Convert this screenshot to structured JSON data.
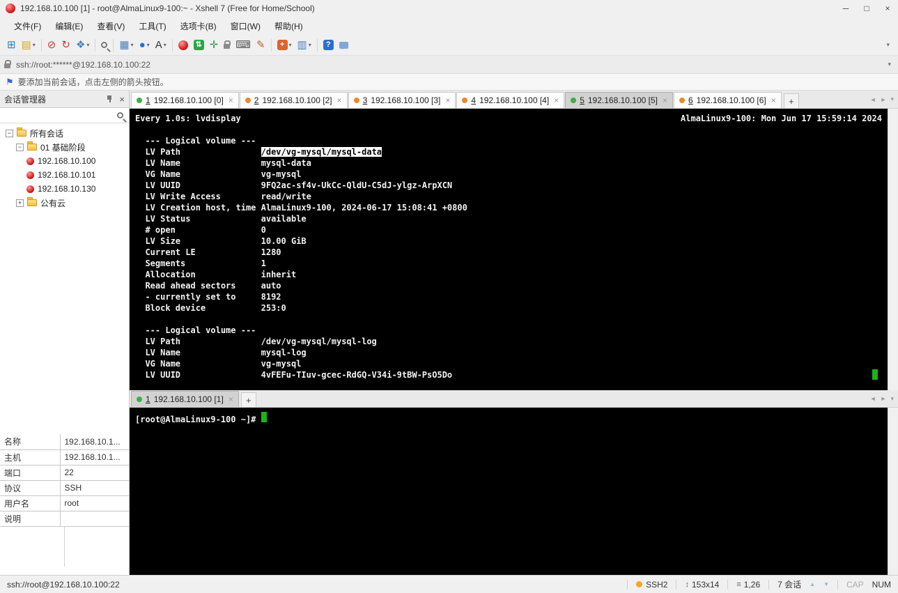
{
  "window": {
    "title": "192.168.10.100 [1] - root@AlmaLinux9-100:~ - Xshell 7 (Free for Home/School)"
  },
  "icons": {
    "caret_down": "▾",
    "scroll_left": "◄",
    "scroll_right": "►",
    "close": "×",
    "plus": "+",
    "minimize": "─",
    "maximize": "□",
    "flag": "⚑",
    "size_icon": "↕",
    "pos_icon": "≡",
    "up_arrow": "▲",
    "down_arrow": "▼",
    "search": "css-magnifier-shape",
    "lock": "css-padlock-shape",
    "pushpin": "css-pushpin-shape"
  },
  "menu": {
    "items": [
      {
        "key": "file",
        "label": "文件(F)"
      },
      {
        "key": "edit",
        "label": "编辑(E)"
      },
      {
        "key": "view",
        "label": "查看(V)"
      },
      {
        "key": "tools",
        "label": "工具(T)"
      },
      {
        "key": "tab",
        "label": "选项卡(B)"
      },
      {
        "key": "window",
        "label": "窗口(W)"
      },
      {
        "key": "help",
        "label": "帮助(H)"
      }
    ]
  },
  "toolbar": {
    "icons": [
      {
        "key": "new-session",
        "glyph": "⊞",
        "color": "#1f7fbf"
      },
      {
        "key": "open-folder",
        "glyph": "▤",
        "color": "#d9a520",
        "caret": true
      },
      {
        "sep": true
      },
      {
        "key": "disconnect",
        "glyph": "⊘",
        "color": "#cc3333"
      },
      {
        "key": "reconnect",
        "glyph": "↻",
        "color": "#cc3333"
      },
      {
        "key": "session-properties",
        "glyph": "❖",
        "color": "#4a7ebb",
        "caret": true
      },
      {
        "sep": true
      },
      {
        "key": "search",
        "glyph": "",
        "color": "#777"
      },
      {
        "sep": true
      },
      {
        "key": "compose-pane",
        "glyph": "▦",
        "color": "#4a7ebb",
        "caret": true
      },
      {
        "key": "web-browser",
        "glyph": "●",
        "color": "#2a6fd0",
        "caret": true
      },
      {
        "key": "font-color",
        "glyph": "A",
        "color": "#333",
        "caret": true
      },
      {
        "sep": true
      },
      {
        "key": "xshell",
        "glyph": "",
        "color": "#cc2222"
      },
      {
        "key": "xftp",
        "glyph": "⇅",
        "bg": "#27a745",
        "color": "#fff"
      },
      {
        "key": "fullscreen",
        "glyph": "✛",
        "color": "#2f9e44"
      },
      {
        "key": "lock-screen",
        "glyph": "",
        "color": "#888"
      },
      {
        "key": "virtual-keyboard",
        "glyph": "⌨",
        "color": "#555"
      },
      {
        "key": "highlighter",
        "glyph": "✎",
        "color": "#b5651d"
      },
      {
        "sep": true
      },
      {
        "key": "new-terminal",
        "glyph": "+",
        "bg": "#e0622d",
        "color": "#fff",
        "caret": true
      },
      {
        "key": "tile-layout",
        "glyph": "▥",
        "color": "#4a7ebb",
        "caret": true
      },
      {
        "sep": true
      },
      {
        "key": "help",
        "glyph": "?",
        "bg": "#2a6fd0",
        "color": "#fff"
      },
      {
        "key": "feedback",
        "glyph": "",
        "color": "#7fa8d9"
      }
    ]
  },
  "address_bar": {
    "value": "ssh://root:******@192.168.10.100:22"
  },
  "info_bar": {
    "text": "要添加当前会话，点击左侧的箭头按钮。"
  },
  "session_manager": {
    "title": "会话管理器",
    "tree": [
      {
        "key": "all-sessions",
        "label": "所有会话",
        "type": "folder",
        "level": 0,
        "expander": "−"
      },
      {
        "key": "stage-01",
        "label": "01 基础阶段",
        "type": "folder",
        "level": 1,
        "expander": "−"
      },
      {
        "key": "session-192-168-10-100",
        "label": "192.168.10.100",
        "type": "session",
        "level": 2
      },
      {
        "key": "session-192-168-10-101",
        "label": "192.168.10.101",
        "type": "session",
        "level": 2
      },
      {
        "key": "session-192-168-10-130",
        "label": "192.168.10.130",
        "type": "session",
        "level": 2
      },
      {
        "key": "public-cloud",
        "label": "公有云",
        "type": "folder",
        "level": 1,
        "expander": "+"
      }
    ],
    "properties": [
      {
        "label": "名称",
        "value": "192.168.10.1..."
      },
      {
        "label": "主机",
        "value": "192.168.10.1..."
      },
      {
        "label": "端口",
        "value": "22"
      },
      {
        "label": "协议",
        "value": "SSH"
      },
      {
        "label": "用户名",
        "value": "root"
      },
      {
        "label": "说明",
        "value": ""
      }
    ]
  },
  "tabs": {
    "top": [
      {
        "num": "1",
        "label": "192.168.10.100 [0]",
        "dot": "#3cb043",
        "active": false
      },
      {
        "num": "2",
        "label": "192.168.10.100 [2]",
        "dot": "#e78a2e",
        "active": false
      },
      {
        "num": "3",
        "label": "192.168.10.100 [3]",
        "dot": "#e78a2e",
        "active": false
      },
      {
        "num": "4",
        "label": "192.168.10.100 [4]",
        "dot": "#e78a2e",
        "active": false
      },
      {
        "num": "5",
        "label": "192.168.10.100 [5]",
        "dot": "#3cb043",
        "active": true
      },
      {
        "num": "6",
        "label": "192.168.10.100 [6]",
        "dot": "#e78a2e",
        "active": false
      }
    ],
    "bottom": [
      {
        "num": "1",
        "label": "192.168.10.100 [1]",
        "dot": "#3cb043",
        "active": true
      }
    ]
  },
  "terminal_top": {
    "header_left": "Every 1.0s: lvdisplay",
    "header_right": "AlmaLinux9-100: Mon Jun 17 15:59:14 2024",
    "highlight": "/dev/vg-mysql/mysql-data",
    "lines": [
      "",
      "  --- Logical volume ---",
      "  LV Path                /dev/vg-mysql/mysql-data",
      "  LV Name                mysql-data",
      "  VG Name                vg-mysql",
      "  LV UUID                9FQ2ac-sf4v-UkCc-QldU-C5dJ-ylgz-ArpXCN",
      "  LV Write Access        read/write",
      "  LV Creation host, time AlmaLinux9-100, 2024-06-17 15:08:41 +0800",
      "  LV Status              available",
      "  # open                 0",
      "  LV Size                10.00 GiB",
      "  Current LE             1280",
      "  Segments               1",
      "  Allocation             inherit",
      "  Read ahead sectors     auto",
      "  - currently set to     8192",
      "  Block device           253:0",
      "",
      "  --- Logical volume ---",
      "  LV Path                /dev/vg-mysql/mysql-log",
      "  LV Name                mysql-log",
      "  VG Name                vg-mysql",
      "  LV UUID                4vFEFu-TIuv-gcec-RdGQ-V34i-9tBW-PsO5Do"
    ]
  },
  "terminal_bottom": {
    "prompt": "[root@AlmaLinux9-100 ~]# "
  },
  "status_bar": {
    "left": "ssh://root@192.168.10.100:22",
    "protocol": "SSH2",
    "terminal_size": "153x14",
    "cursor_position": "1,26",
    "session_count": "7 会话",
    "cap": "CAP",
    "num": "NUM"
  }
}
